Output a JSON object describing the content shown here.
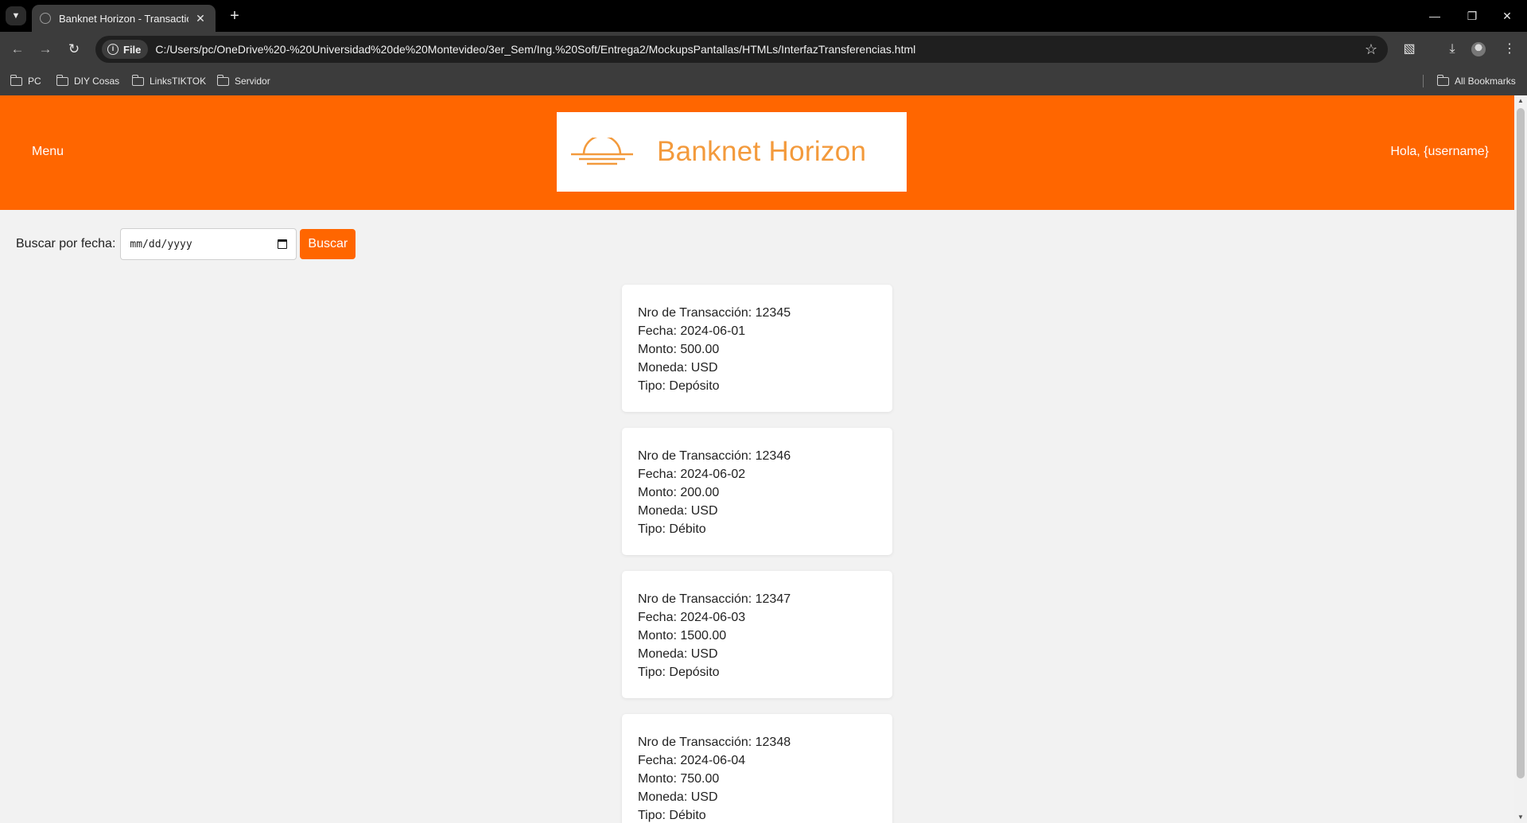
{
  "browser": {
    "tab_title": "Banknet Horizon - Transaction H",
    "url_chip": "File",
    "url": "C:/Users/pc/OneDrive%20-%20Universidad%20de%20Montevideo/3er_Sem/Ing.%20Soft/Entrega2/MockupsPantallas/HTMLs/InterfazTransferencias.html",
    "bookmarks": [
      "PC",
      "DIY Cosas",
      "LinksTIKTOK",
      "Servidor"
    ],
    "all_bookmarks": "All Bookmarks"
  },
  "header": {
    "menu": "Menu",
    "logo_text": "Banknet Horizon",
    "greeting": "Hola, {username}",
    "color": "#ff6600"
  },
  "search": {
    "label": "Buscar por fecha:",
    "date_placeholder": "mm/dd/yyyy",
    "button": "Buscar"
  },
  "transactions": [
    {
      "nro": "Nro de Transacción: 12345",
      "fecha": "Fecha: 2024-06-01",
      "monto": "Monto: 500.00",
      "moneda": "Moneda: USD",
      "tipo": "Tipo: Depósito"
    },
    {
      "nro": "Nro de Transacción: 12346",
      "fecha": "Fecha: 2024-06-02",
      "monto": "Monto: 200.00",
      "moneda": "Moneda: USD",
      "tipo": "Tipo: Débito"
    },
    {
      "nro": "Nro de Transacción: 12347",
      "fecha": "Fecha: 2024-06-03",
      "monto": "Monto: 1500.00",
      "moneda": "Moneda: USD",
      "tipo": "Tipo: Depósito"
    },
    {
      "nro": "Nro de Transacción: 12348",
      "fecha": "Fecha: 2024-06-04",
      "monto": "Monto: 750.00",
      "moneda": "Moneda: USD",
      "tipo": "Tipo: Débito"
    }
  ]
}
